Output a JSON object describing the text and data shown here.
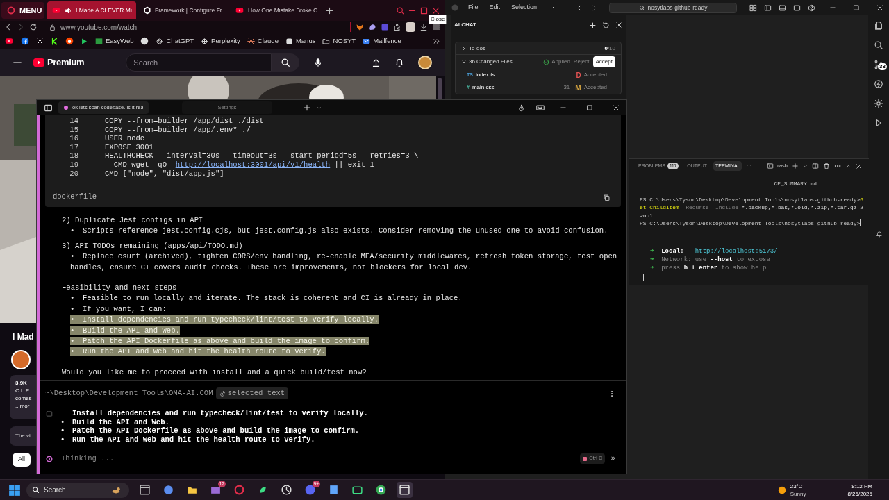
{
  "browser": {
    "menu_label": "MENU",
    "tabs": [
      {
        "title": "I Made A CLEVER Mi",
        "selected": true
      },
      {
        "title": "Framework | Configure Fr",
        "selected": false
      },
      {
        "title": "How One Mistake Broke C",
        "selected": false
      }
    ],
    "tooltip": "Close",
    "address": "www.youtube.com/watch",
    "bookmarks": [
      "EasyWeb",
      "ChatGPT",
      "Perplexity",
      "Claude",
      "Manus",
      "NOSYT",
      "Mailfence"
    ],
    "youtube": {
      "logo_text": "Premium",
      "search_placeholder": "Search",
      "video_title": "I Mad",
      "description": [
        "3.9K",
        "C.L.E.",
        "comes",
        "...mor"
      ],
      "comment_preview": "The vi",
      "chip": {
        "label": "All",
        "selected": true
      }
    }
  },
  "vscode": {
    "menu": [
      "File",
      "Edit",
      "Selection",
      "···"
    ],
    "command_center": "nosytlabs-github-ready",
    "source_control_badge": "33",
    "ai_chat": {
      "title": "AI CHAT",
      "todos": {
        "label": "To-dos",
        "done": "0",
        "total": "/10",
        "expanded": false
      },
      "changes": {
        "label": "36 Changed Files",
        "expanded": true,
        "applied": "Applied",
        "reject": "Reject",
        "accept": "Accept",
        "files": [
          {
            "type_icon": "TS",
            "name": "index.ts",
            "status": "D",
            "color": "#e05252",
            "state": "Accepted"
          },
          {
            "type_icon": "#",
            "name": "main.css",
            "delta": "-31",
            "status": "M",
            "color": "#d7a641",
            "state": "Accepted"
          }
        ]
      }
    },
    "panel": {
      "tabs": [
        {
          "label": "PROBLEMS",
          "badge": "117",
          "selected": false
        },
        {
          "label": "OUTPUT",
          "selected": false
        },
        {
          "label": "TERMINAL",
          "selected": true
        }
      ],
      "more": "···",
      "shell": "pwsh",
      "file_hint": "CE_SUMMARY.md",
      "lines": [
        [
          {
            "kind": "prompt",
            "text": "PS C:\\Users\\Tyson\\Desktop\\Development Tools\\nosytlabs-github-ready>"
          },
          {
            "kind": "cmd",
            "text": "G"
          }
        ],
        [
          {
            "kind": "cmd",
            "text": "et-ChildItem"
          },
          {
            "kind": "param",
            "text": " -Recurse -Include "
          },
          {
            "kind": "arg",
            "text": "*.backup,*.bak,*.old,*.zip,*.tar.gz 2"
          }
        ],
        [
          {
            "kind": "arg",
            "text": ">nul"
          }
        ],
        [
          {
            "kind": "prompt",
            "text": "PS C:\\Users\\Tyson\\Desktop\\Development Tools\\nosytlabs-github-ready>"
          }
        ]
      ]
    },
    "dev_server": {
      "lines": [
        [
          {
            "kind": "arrow",
            "text": "➜"
          },
          {
            "kind": "bold",
            "text": "  Local:   "
          },
          {
            "kind": "link",
            "text": "http://localhost:5173/"
          }
        ],
        [
          {
            "kind": "arrow",
            "text": "➜"
          },
          {
            "kind": "dim",
            "text": "  Network: use "
          },
          {
            "kind": "bold",
            "text": "--host"
          },
          {
            "kind": "dim",
            "text": " to expose"
          }
        ],
        [
          {
            "kind": "arrow",
            "text": "➜"
          },
          {
            "kind": "dim",
            "text": "  press "
          },
          {
            "kind": "bold",
            "text": "h + enter"
          },
          {
            "kind": "dim",
            "text": " to show help"
          }
        ]
      ]
    }
  },
  "agent_window": {
    "tabs": [
      {
        "title": "ok lets scan codebase. is it rea",
        "selected": true,
        "color": "#e26ee0"
      },
      {
        "title": "Settings",
        "selected": false
      }
    ],
    "code": {
      "label": "dockerfile",
      "lines": [
        {
          "num": "14",
          "segments": [
            {
              "kind": "code",
              "text": "COPY --from=builder /app/dist ./dist"
            }
          ]
        },
        {
          "num": "15",
          "segments": [
            {
              "kind": "code",
              "text": "COPY --from=builder /app/.env* ./"
            }
          ]
        },
        {
          "num": "16",
          "segments": [
            {
              "kind": "code",
              "text": "USER node"
            }
          ]
        },
        {
          "num": "17",
          "segments": [
            {
              "kind": "code",
              "text": "EXPOSE 3001"
            }
          ]
        },
        {
          "num": "18",
          "segments": [
            {
              "kind": "code",
              "text": "HEALTHCHECK --interval=30s --timeout=3s --start-period=5s --retries=3 \\"
            }
          ]
        },
        {
          "num": "19",
          "segments": [
            {
              "kind": "code",
              "text": "  CMD wget -qO- "
            },
            {
              "kind": "link",
              "text": "http://localhost:3001/api/v1/health"
            },
            {
              "kind": "code",
              "text": " || exit 1"
            }
          ]
        },
        {
          "num": "20",
          "segments": [
            {
              "kind": "code",
              "text": "CMD [\"node\", \"dist/app.js\"]"
            }
          ]
        }
      ]
    },
    "blocks": [
      {
        "kind": "heading",
        "text": "2) Duplicate Jest configs in API"
      },
      {
        "kind": "bullet",
        "marker": "•",
        "text": "Scripts reference jest.config.cjs, but jest.config.js also exists. Consider removing the unused one to avoid confusion.",
        "highlighted": false
      },
      {
        "kind": "heading",
        "text": "3) API TODOs remaining (apps/api/TODO.md)"
      },
      {
        "kind": "bullet",
        "marker": "•",
        "text": "Replace csurf (archived), tighten CORS/env handling, re-enable MFA/security middlewares, refresh token storage, test open handles, ensure CI covers audit checks. These are improvements, not blockers for local dev.",
        "highlighted": false
      },
      {
        "kind": "section",
        "text": "Feasibility and next steps"
      },
      {
        "kind": "bullet",
        "marker": "•",
        "text": "Feasible to run locally and iterate. The stack is coherent and CI is already in place.",
        "highlighted": false
      },
      {
        "kind": "bullet",
        "marker": "•",
        "text": "If you want, I can:",
        "highlighted": false
      },
      {
        "kind": "bullet",
        "marker": "•",
        "text": "Install dependencies and run typecheck/lint/test to verify locally.",
        "highlighted": true
      },
      {
        "kind": "bullet",
        "marker": "•",
        "text": "Build the API and Web.",
        "highlighted": true
      },
      {
        "kind": "bullet",
        "marker": "•",
        "text": "Patch the API Dockerfile as above and build the image to confirm.",
        "highlighted": true
      },
      {
        "kind": "bullet",
        "marker": "•",
        "text": "Run the API and Web and hit the health route to verify.",
        "highlighted": true
      },
      {
        "kind": "paragraph",
        "text": "Would you like me to proceed with install and a quick build/test now?"
      }
    ],
    "prompt": {
      "path": "~\\Desktop\\Development Tools\\OMA-AI.COM",
      "chip": "selected text",
      "echo": [
        {
          "text": "Install dependencies and run typecheck/lint/test to verify locally."
        },
        {
          "marker": "•",
          "text": "Build the API and Web."
        },
        {
          "marker": "•",
          "text": "Patch the API Dockerfile as above and build the image to confirm."
        },
        {
          "marker": "•",
          "text": "Run the API and Web and hit the health route to verify."
        }
      ],
      "status": "Thinking ...",
      "stop": "Ctrl C",
      "more": "»"
    }
  },
  "taskbar": {
    "search": "Search",
    "badges": [
      "12",
      "9+"
    ],
    "temperature": "23°C",
    "weather": "Sunny",
    "time": "8:12 PM",
    "date": "8/26/2025"
  }
}
